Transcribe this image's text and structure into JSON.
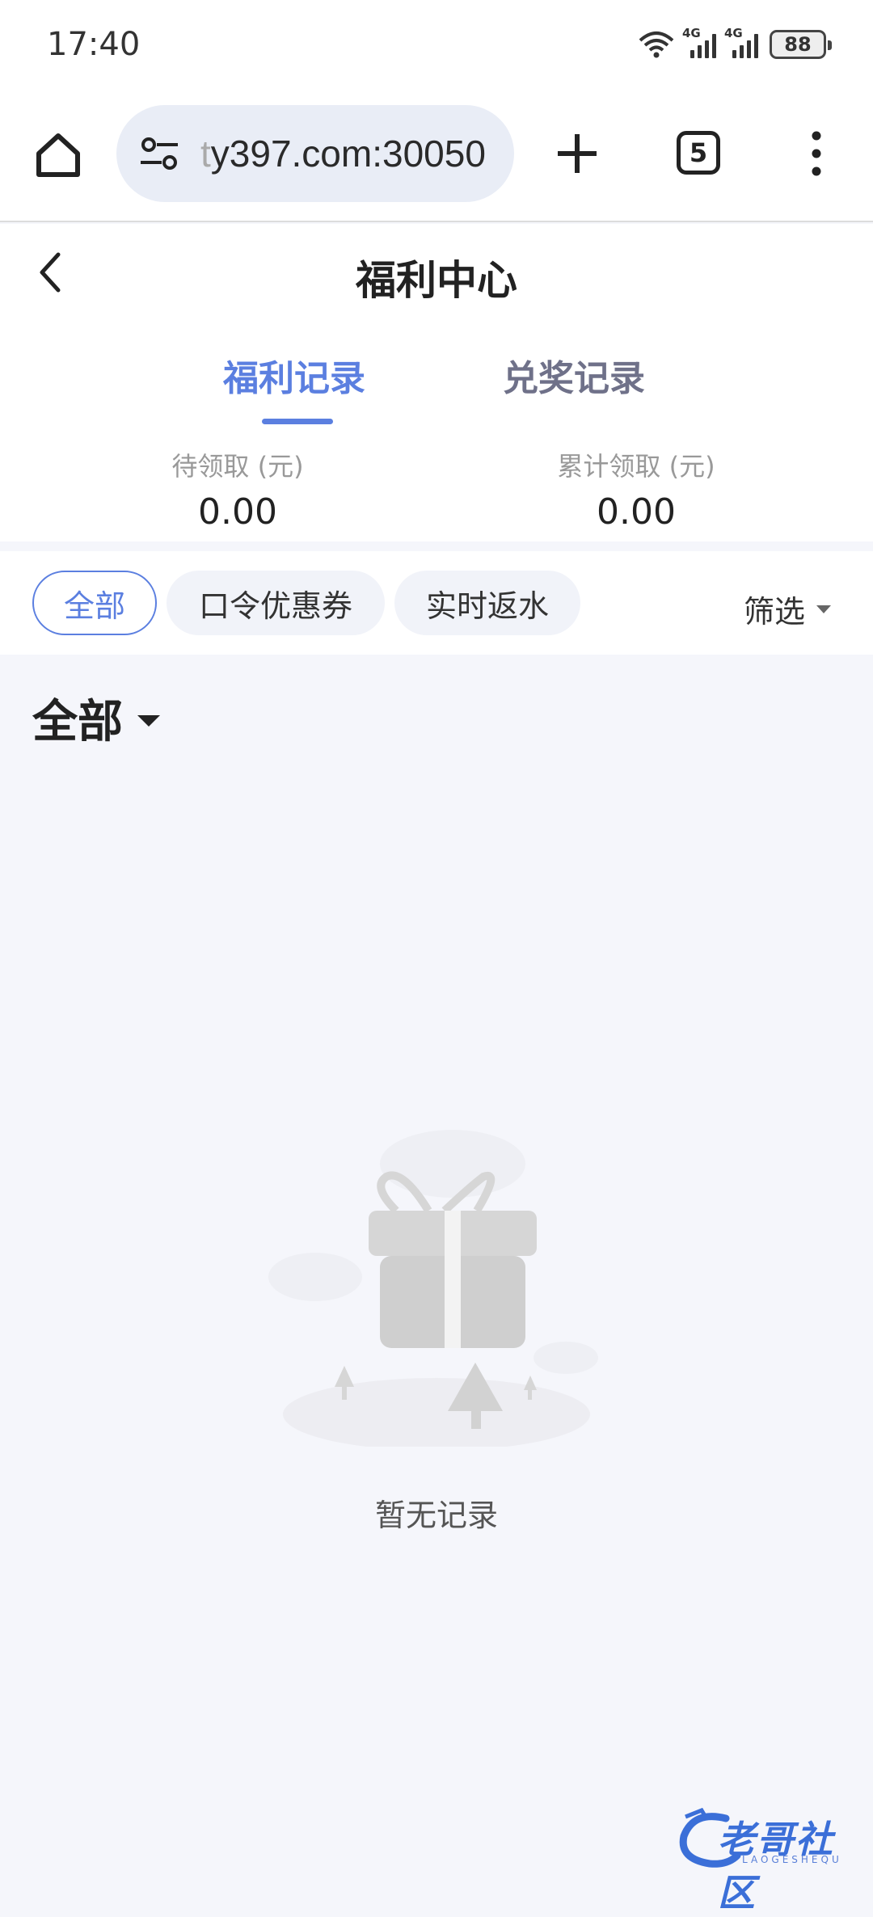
{
  "status_bar": {
    "time": "17:40",
    "network_1": "4G",
    "network_2": "4G",
    "battery": "88"
  },
  "browser": {
    "url_faded": "t",
    "url": "y397.com:30050",
    "tab_count": "5"
  },
  "header": {
    "title": "福利中心"
  },
  "tabs": [
    {
      "label": "福利记录",
      "active": true
    },
    {
      "label": "兑奖记录",
      "active": false
    }
  ],
  "stats": {
    "pending_label": "待领取 (元)",
    "pending_value": "0.00",
    "total_label": "累计领取 (元)",
    "total_value": "0.00"
  },
  "filters": {
    "chips": [
      "全部",
      "口令优惠券",
      "实时返水"
    ],
    "filter_label": "筛选"
  },
  "content": {
    "section_title": "全部",
    "empty_text": "暂无记录"
  },
  "watermark": {
    "text": "老哥社区",
    "sub": "LAOGESHEQU"
  },
  "colors": {
    "accent": "#5b7fe0",
    "page_bg": "#f5f6fb"
  }
}
